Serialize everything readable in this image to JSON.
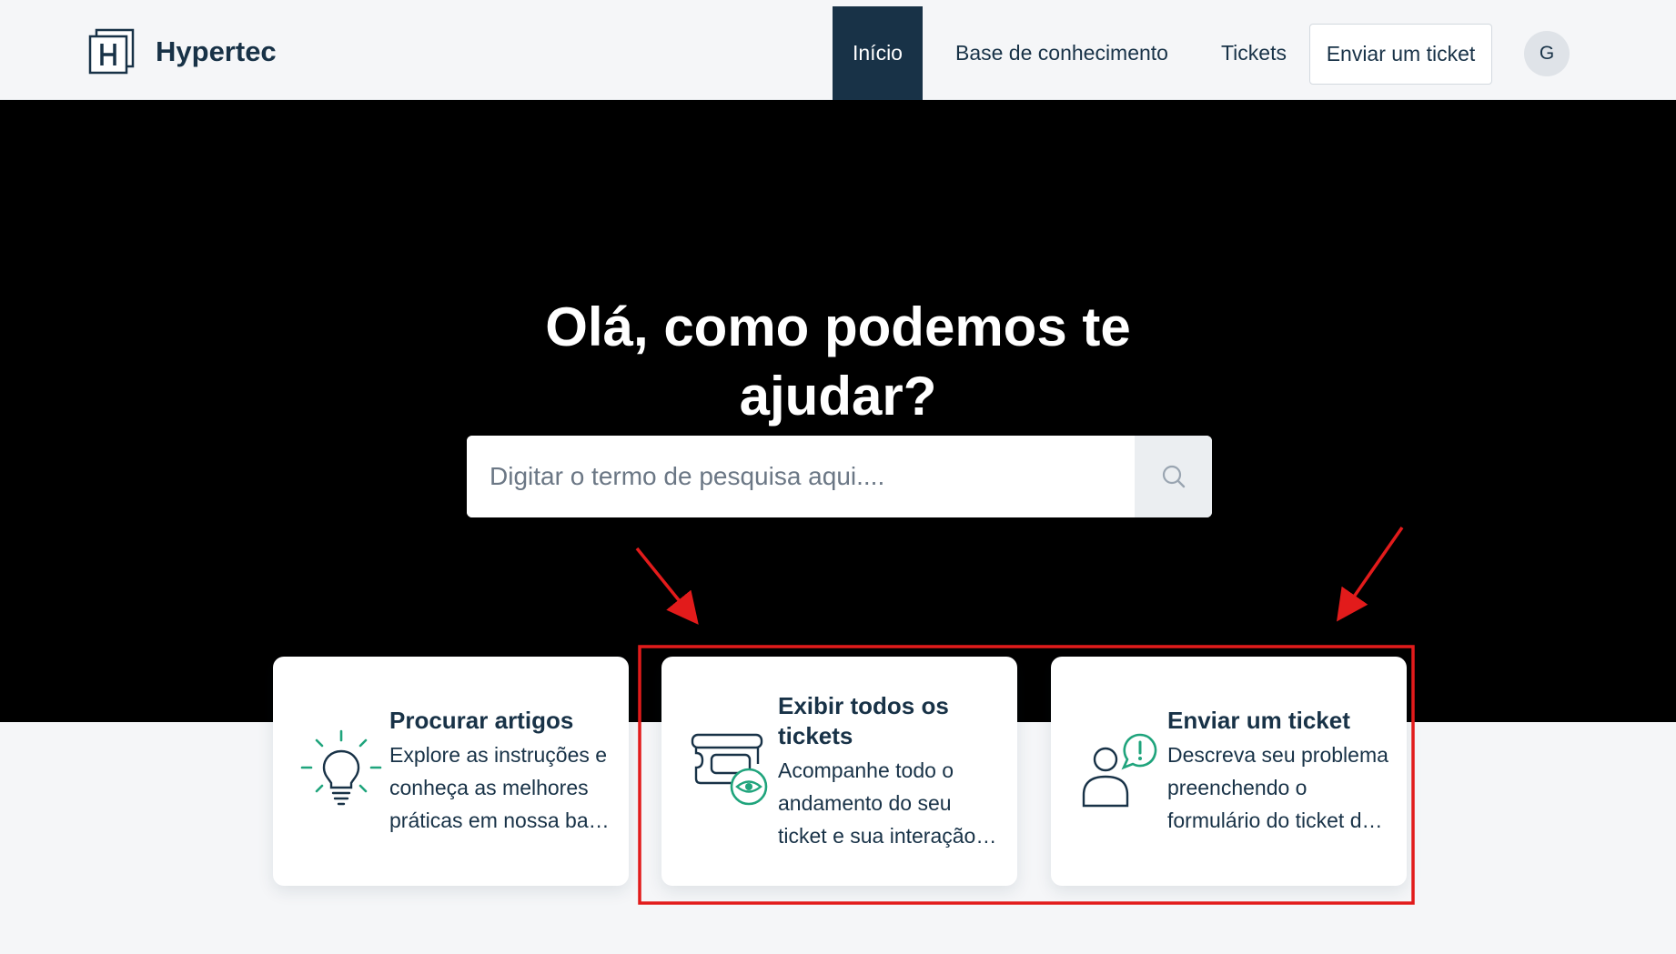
{
  "header": {
    "brand_name": "Hypertec",
    "nav": [
      {
        "label": "Início",
        "active": true
      },
      {
        "label": "Base de conhecimento",
        "active": false
      },
      {
        "label": "Tickets",
        "active": false
      }
    ],
    "submit_button": "Enviar um ticket",
    "avatar_initial": "G"
  },
  "hero": {
    "title": "Olá, como podemos te ajudar?",
    "search_placeholder": "Digitar o termo de pesquisa aqui...."
  },
  "cards": [
    {
      "title": "Procurar artigos",
      "description": "Explore as instruções e conheça as melhores práticas em nossa base de conhecimento",
      "icon": "lightbulb-icon"
    },
    {
      "title": "Exibir todos os tickets",
      "description": "Acompanhe todo o andamento do seu ticket e sua interação com a equipe",
      "icon": "tickets-eye-icon"
    },
    {
      "title": "Enviar um ticket",
      "description": "Descreva seu problema preenchendo o formulário do ticket de suporte",
      "icon": "user-alert-icon"
    }
  ],
  "colors": {
    "primary": "#183247",
    "accent": "#1fa47c",
    "hero_bg": "#000000",
    "page_bg": "#f5f6f8",
    "annotation": "#e21b1b"
  }
}
